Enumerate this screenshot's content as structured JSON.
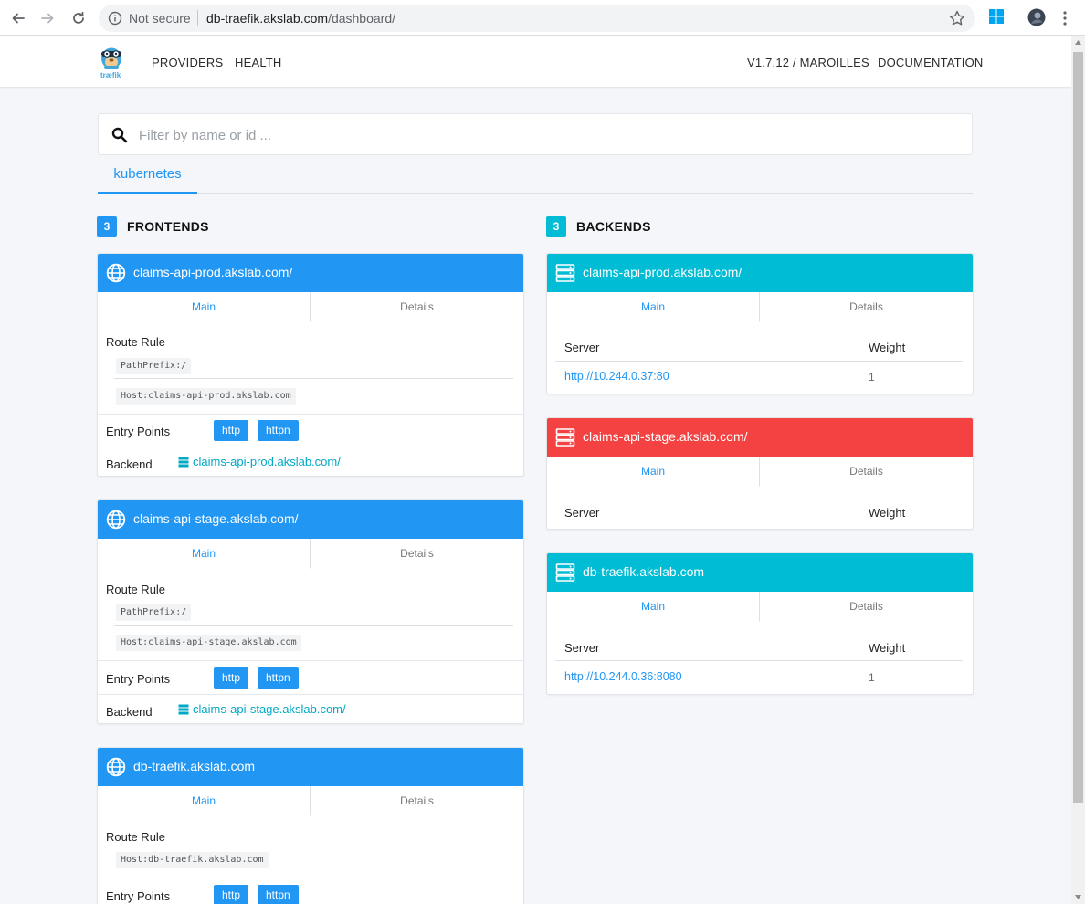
{
  "browser": {
    "security_text": "Not secure",
    "url_host": "db-traefik.akslab.com",
    "url_path": "/dashboard/"
  },
  "header": {
    "logo_text": "træfik",
    "nav": [
      "PROVIDERS",
      "HEALTH"
    ],
    "version": "V1.7.12 / MAROILLES",
    "documentation": "DOCUMENTATION"
  },
  "filter": {
    "placeholder": "Filter by name or id ..."
  },
  "provider_tab": "kubernetes",
  "frontends": {
    "count": "3",
    "title": "FRONTENDS",
    "tabs": {
      "main": "Main",
      "details": "Details"
    },
    "labels": {
      "route_rule": "Route Rule",
      "entry_points": "Entry Points",
      "backend": "Backend"
    },
    "items": [
      {
        "name": "claims-api-prod.akslab.com/",
        "rules": [
          "PathPrefix:/",
          "Host:claims-api-prod.akslab.com"
        ],
        "entry_points": [
          "http",
          "httpn"
        ],
        "backend": "claims-api-prod.akslab.com/"
      },
      {
        "name": "claims-api-stage.akslab.com/",
        "rules": [
          "PathPrefix:/",
          "Host:claims-api-stage.akslab.com"
        ],
        "entry_points": [
          "http",
          "httpn"
        ],
        "backend": "claims-api-stage.akslab.com/"
      },
      {
        "name": "db-traefik.akslab.com",
        "rules": [
          "Host:db-traefik.akslab.com"
        ],
        "entry_points": [
          "http",
          "httpn"
        ]
      }
    ]
  },
  "backends": {
    "count": "3",
    "title": "BACKENDS",
    "tabs": {
      "main": "Main",
      "details": "Details"
    },
    "columns": {
      "server": "Server",
      "weight": "Weight"
    },
    "items": [
      {
        "name": "claims-api-prod.akslab.com/",
        "status": "ok",
        "servers": [
          {
            "url": "http://10.244.0.37:80",
            "weight": "1"
          }
        ]
      },
      {
        "name": "claims-api-stage.akslab.com/",
        "status": "error",
        "servers": []
      },
      {
        "name": "db-traefik.akslab.com",
        "status": "ok",
        "servers": [
          {
            "url": "http://10.244.0.36:8080",
            "weight": "1"
          }
        ]
      }
    ]
  },
  "colors": {
    "frontend_header": "#2196f3",
    "backend_ok": "#00bcd4",
    "backend_error": "#f44336",
    "link": "#2196f3",
    "badge_frontend": "#2196f3",
    "badge_backend": "#00bcd4"
  },
  "icons": {
    "frontend": "globe-icon",
    "backend": "server-icon",
    "search": "search-icon"
  }
}
